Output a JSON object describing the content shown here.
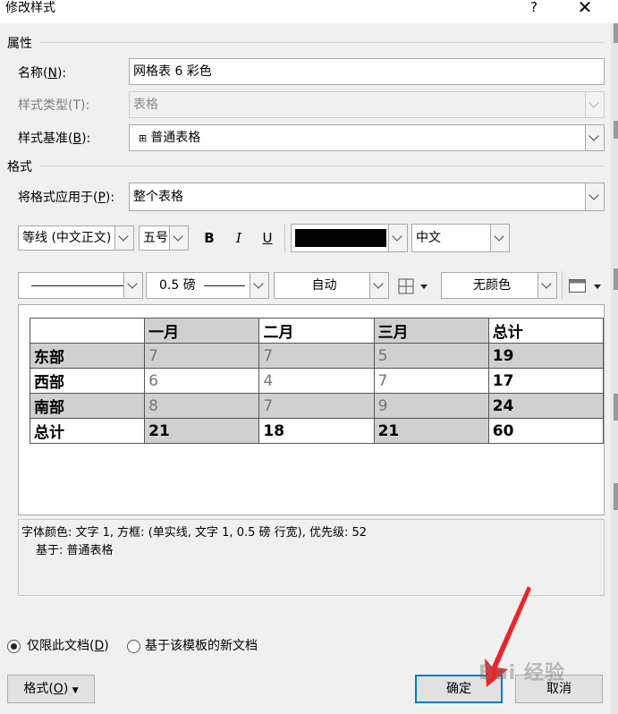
{
  "window": {
    "title": "修改样式",
    "help": "?",
    "close": "✕"
  },
  "properties": {
    "section": "属性",
    "name_label": "名称(",
    "name_key": "N",
    "name_label_end": "):",
    "name_value": "网格表 6 彩色",
    "type_label": "样式类型(T):",
    "type_value": "表格",
    "base_label": "样式基准(",
    "base_key": "B",
    "base_label_end": "):",
    "base_icon": "⊞",
    "base_value": "普通表格"
  },
  "format": {
    "section": "格式",
    "apply_label": "将格式应用于(",
    "apply_key": "P",
    "apply_label_end": "):",
    "apply_value": "整个表格",
    "font": "等线 (中文正文)",
    "size": "五号",
    "bold": "B",
    "italic": "I",
    "underline": "U",
    "font_color": "#000000",
    "lang": "中文",
    "border_width": "0.5 磅",
    "border_color": "自动",
    "shading": "无颜色"
  },
  "preview": {
    "header": [
      "",
      "一月",
      "二月",
      "三月",
      "总计"
    ],
    "rows": [
      [
        "东部",
        "7",
        "7",
        "5",
        "19"
      ],
      [
        "西部",
        "6",
        "4",
        "7",
        "17"
      ],
      [
        "南部",
        "8",
        "7",
        "9",
        "24"
      ],
      [
        "总计",
        "21",
        "18",
        "21",
        "60"
      ]
    ]
  },
  "description": {
    "line1": "字体颜色: 文字 1, 方框: (单实线, 文字 1,  0.5 磅 行宽), 优先级: 52",
    "line2": "基于: 普通表格"
  },
  "options": {
    "only_doc_label": "仅限此文档(",
    "only_doc_key": "D",
    "only_doc_end": ")",
    "new_doc_label": "基于该模板的新文档"
  },
  "buttons": {
    "format": "格式(",
    "format_key": "O",
    "format_end": ")",
    "ok": "确定",
    "cancel": "取消"
  },
  "watermark": "Bai 经验"
}
